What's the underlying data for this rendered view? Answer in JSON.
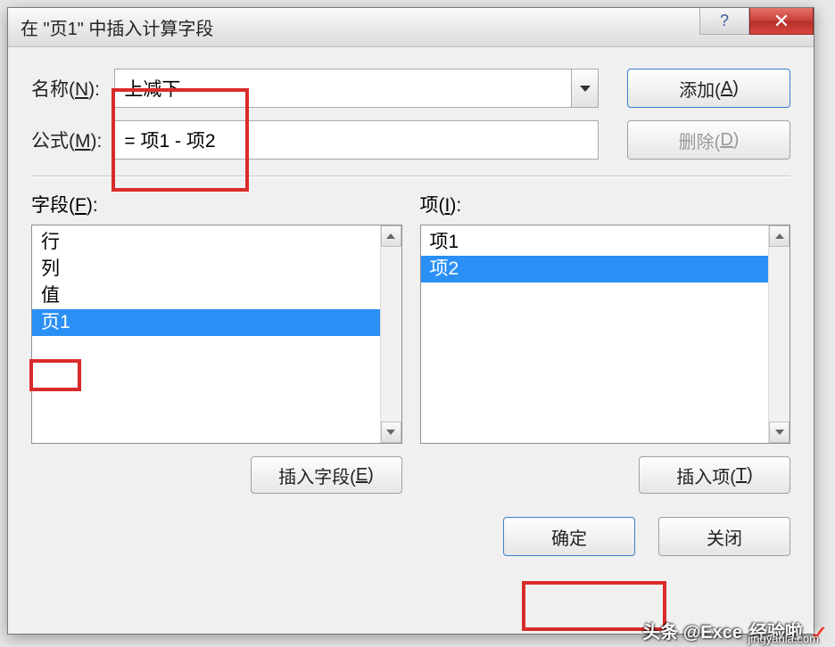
{
  "dialog": {
    "title": "在 \"页1\" 中插入计算字段"
  },
  "form": {
    "name_label_pre": "名称(",
    "name_label_u": "N",
    "name_label_post": "):",
    "name_value": "上减下",
    "formula_label_pre": "公式(",
    "formula_label_u": "M",
    "formula_label_post": "):",
    "formula_value": "= 项1 - 项2"
  },
  "buttons": {
    "add_pre": "添加(",
    "add_u": "A",
    "add_post": ")",
    "delete_pre": "删除(",
    "delete_u": "D",
    "delete_post": ")",
    "insert_field_pre": "插入字段(",
    "insert_field_u": "E",
    "insert_field_post": ")",
    "insert_item_pre": "插入项(",
    "insert_item_u": "T",
    "insert_item_post": ")",
    "ok": "确定",
    "close": "关闭"
  },
  "lists": {
    "fields_label_pre": "字段(",
    "fields_label_u": "F",
    "fields_label_post": "):",
    "items_label_pre": "项(",
    "items_label_u": "I",
    "items_label_post": "):",
    "fields": {
      "i0": "行",
      "i1": "列",
      "i2": "值",
      "i3": "页1"
    },
    "items": {
      "i0": "项1",
      "i1": "项2"
    }
  },
  "watermark": {
    "left": "头条 @Exce",
    "right": "经验啦",
    "url": "jingyanla.com"
  }
}
